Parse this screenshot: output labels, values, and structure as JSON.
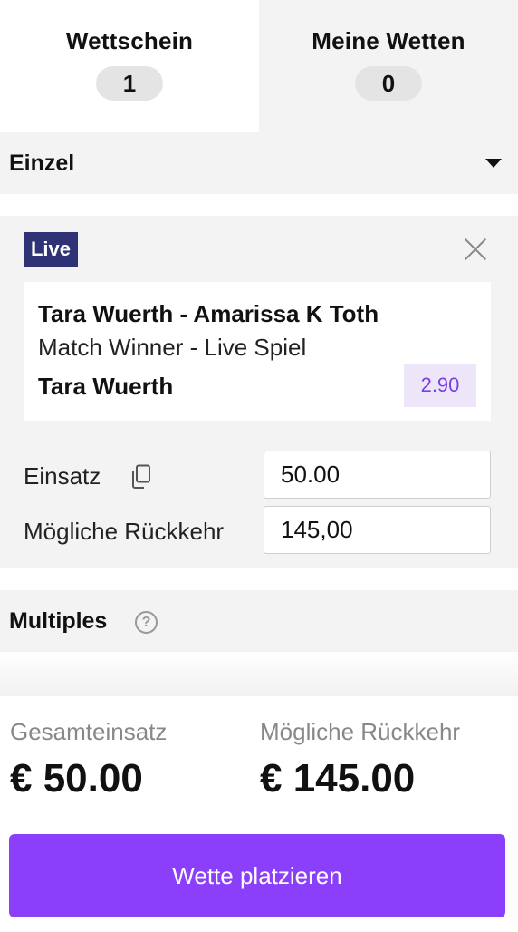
{
  "tabs": [
    {
      "label": "Wettschein",
      "count": "1"
    },
    {
      "label": "Meine Wetten",
      "count": "0"
    }
  ],
  "single": {
    "title": "Einzel"
  },
  "bet": {
    "live_label": "Live",
    "match": "Tara Wuerth - Amarissa K Toth",
    "market": "Match Winner - Live Spiel",
    "selection": "Tara Wuerth",
    "odds": "2.90",
    "stake_label": "Einsatz",
    "stake_value": "50.00",
    "return_label": "Mögliche Rückkehr",
    "return_value": "145,00"
  },
  "multiples": {
    "title": "Multiples",
    "help_glyph": "?"
  },
  "footer": {
    "total_label": "Gesamteinsatz",
    "total_value": "€ 50.00",
    "return_label": "Mögliche Rückkehr",
    "return_value": "€ 145.00",
    "place_button": "Wette platzieren"
  },
  "colors": {
    "accent": "#8c3ffb",
    "live_badge": "#2f3376",
    "odds_bg": "#ede6fb",
    "odds_text": "#7b3fe4"
  },
  "icons": [
    "chevron-down-icon",
    "close-icon",
    "copy-icon",
    "help-icon"
  ]
}
